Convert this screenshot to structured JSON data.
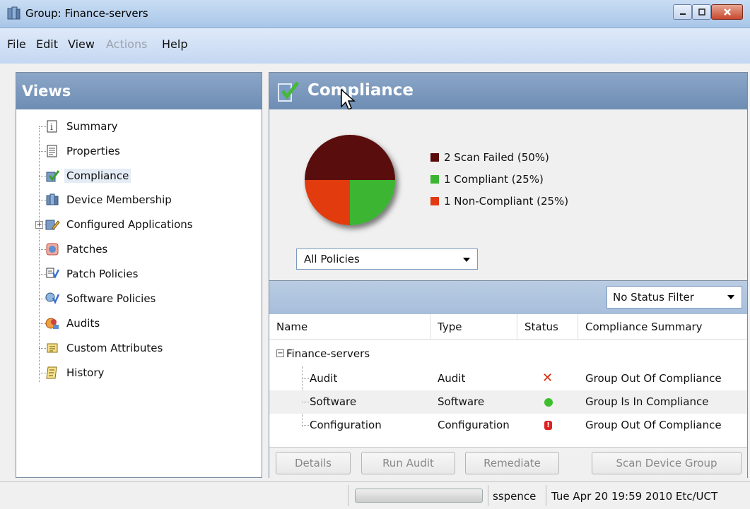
{
  "window": {
    "title": "Group: Finance-servers",
    "icon": "server-group-icon"
  },
  "menu": [
    {
      "label": "File",
      "enabled": true
    },
    {
      "label": "Edit",
      "enabled": true
    },
    {
      "label": "View",
      "enabled": true
    },
    {
      "label": "Actions",
      "enabled": false
    },
    {
      "label": "Help",
      "enabled": true
    }
  ],
  "views": {
    "title": "Views",
    "items": [
      {
        "label": "Summary",
        "icon": "summary-icon"
      },
      {
        "label": "Properties",
        "icon": "properties-icon"
      },
      {
        "label": "Compliance",
        "icon": "compliance-icon",
        "selected": true
      },
      {
        "label": "Device Membership",
        "icon": "device-membership-icon"
      },
      {
        "label": "Configured Applications",
        "icon": "configured-applications-icon",
        "expandable": true
      },
      {
        "label": "Patches",
        "icon": "patches-icon"
      },
      {
        "label": "Patch Policies",
        "icon": "patch-policies-icon"
      },
      {
        "label": "Software Policies",
        "icon": "software-policies-icon"
      },
      {
        "label": "Audits",
        "icon": "audits-icon"
      },
      {
        "label": "Custom Attributes",
        "icon": "custom-attributes-icon"
      },
      {
        "label": "History",
        "icon": "history-icon"
      }
    ]
  },
  "compliance": {
    "title": "Compliance",
    "policy_filter": "All Policies",
    "status_filter": "No Status Filter",
    "columns": [
      "Name",
      "Type",
      "Status",
      "Compliance Summary"
    ],
    "group_row": "Finance-servers",
    "rows": [
      {
        "name": "Audit",
        "type": "Audit",
        "status": "x",
        "summary": "Group Out Of Compliance"
      },
      {
        "name": "Software",
        "type": "Software",
        "status": "ok",
        "summary": "Group Is In Compliance"
      },
      {
        "name": "Configuration",
        "type": "Configuration",
        "status": "warn",
        "summary": "Group Out Of Compliance"
      }
    ],
    "buttons": [
      "Details",
      "Run Audit",
      "Remediate",
      "Scan Device Group"
    ]
  },
  "chart_data": {
    "type": "pie",
    "slices": [
      {
        "label": "2 Scan Failed (50%)",
        "value": 50,
        "color": "#5a0a0a"
      },
      {
        "label": "1 Compliant (25%)",
        "value": 25,
        "color": "#3bb531"
      },
      {
        "label": "1 Non-Compliant (25%)",
        "value": 25,
        "color": "#e23a10"
      }
    ]
  },
  "statusbar": {
    "user": "sspence",
    "datetime": "Tue Apr 20 19:59 2010 Etc/UCT"
  }
}
